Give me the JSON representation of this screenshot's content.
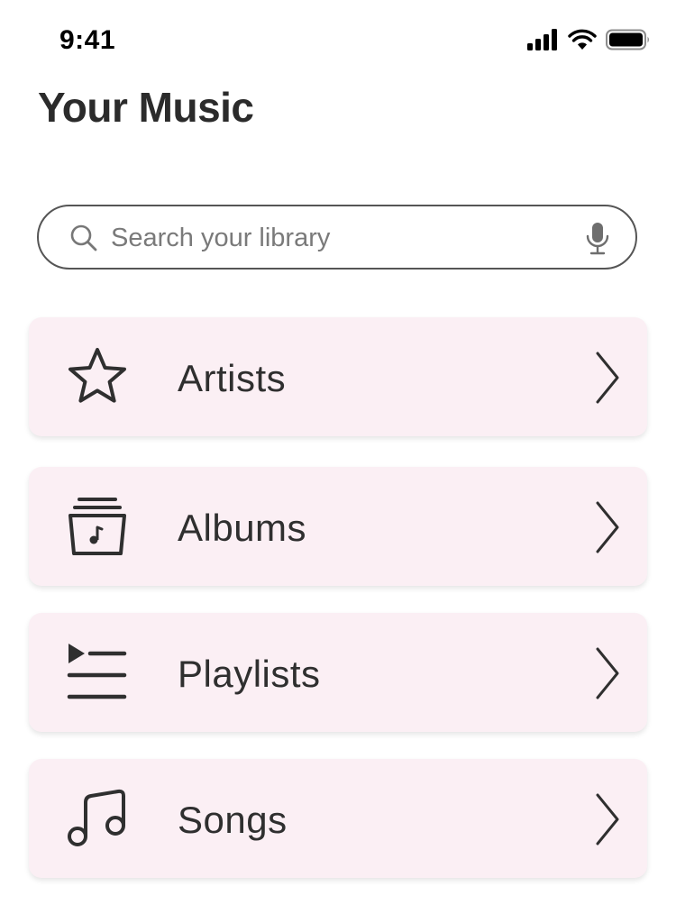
{
  "status_bar": {
    "time": "9:41",
    "icons": [
      "cellular-signal-icon",
      "wifi-icon",
      "battery-icon"
    ]
  },
  "header": {
    "title": "Your Music"
  },
  "search": {
    "placeholder": "Search your library",
    "value": "",
    "icons": [
      "search-icon",
      "microphone-icon"
    ]
  },
  "library": {
    "items": [
      {
        "label": "Artists",
        "icon": "star-icon"
      },
      {
        "label": "Albums",
        "icon": "album-stack-icon"
      },
      {
        "label": "Playlists",
        "icon": "playlist-icon"
      },
      {
        "label": "Songs",
        "icon": "music-note-icon"
      }
    ],
    "chevron_icon": "chevron-right-icon"
  },
  "colors": {
    "item_background": "#fbeff4",
    "text": "#2f2f2f",
    "search_border": "#555555"
  }
}
